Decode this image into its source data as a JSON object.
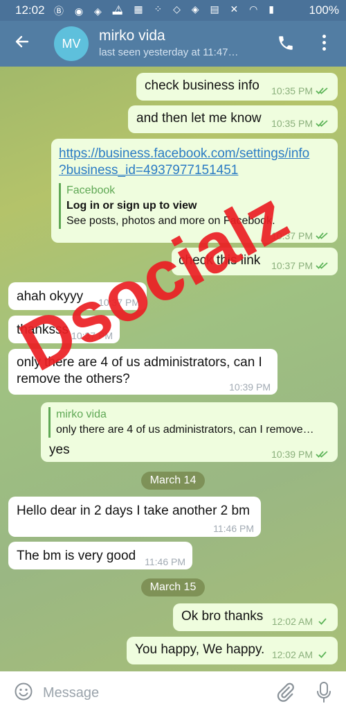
{
  "statusbar": {
    "time": "12:02",
    "left_icons": "Ⓑ ◉ ◈ ▬",
    "right_icons": "⚠ ▦ ⁘ ◇ ◈ ▤ ✕ ◠ ▮",
    "battery": "100%"
  },
  "header": {
    "avatar_initials": "MV",
    "name": "mirko vida",
    "last_seen": "last seen yesterday at 11:47…"
  },
  "messages": [
    {
      "text": "check business info",
      "time": "10:35 PM"
    },
    {
      "text": "and then let me know",
      "time": "10:35 PM"
    },
    {
      "link_line1": "https://business.facebook.com/settings/info",
      "link_line2": "?business_id=4937977151451",
      "site": "Facebook",
      "title": "Log in or sign up to view",
      "desc": "See posts, photos and more on Facebook.",
      "time": "10:37 PM"
    },
    {
      "text": "check this link",
      "time": "10:37 PM"
    },
    {
      "text": "ahah okyyy",
      "time": "10:37 PM"
    },
    {
      "text": "thanksss",
      "time": "10:37 PM"
    },
    {
      "line1": "only there are 4 of us administrators, can I",
      "line2": "remove the others?",
      "time": "10:39 PM"
    },
    {
      "reply_author": "mirko vida",
      "reply_text": "only there are 4 of us administrators, can I remove…",
      "text": "yes",
      "time": "10:39 PM"
    },
    {
      "text": "Hello dear in 2 days I take another 2 bm",
      "time": "11:46 PM"
    },
    {
      "text": "The bm is very good",
      "time": "11:46 PM"
    },
    {
      "text": "Ok bro thanks",
      "time": "12:02 AM"
    },
    {
      "text": "You happy, We happy.",
      "time": "12:02 AM"
    }
  ],
  "dates": [
    "March 14",
    "March 15"
  ],
  "watermark": "Dsocialz",
  "composer": {
    "placeholder": "Message"
  }
}
